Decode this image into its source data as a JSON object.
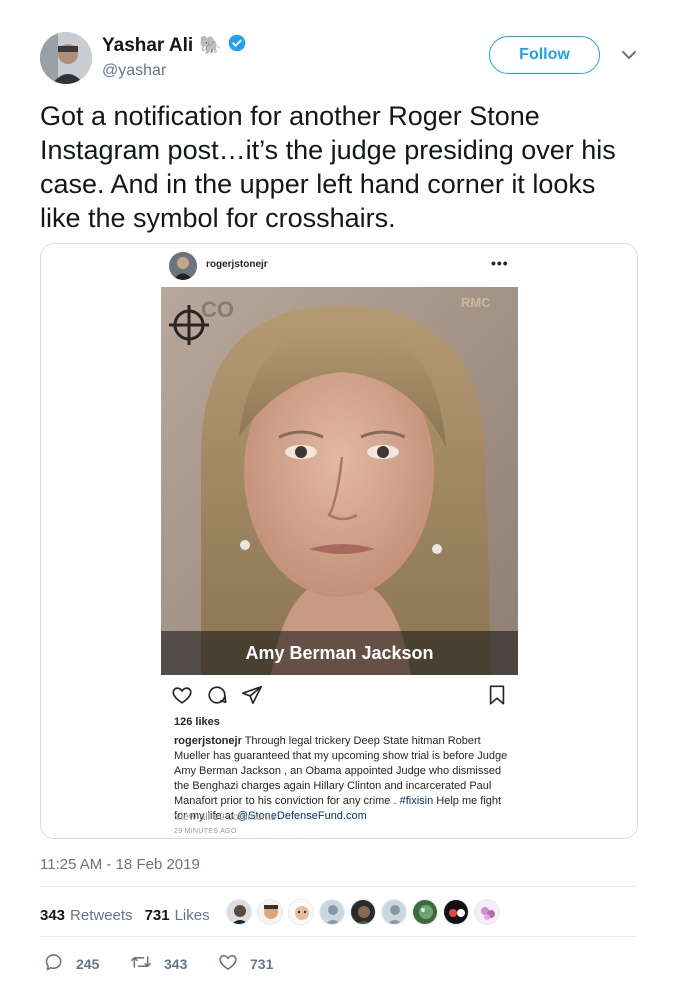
{
  "author": {
    "name": "Yashar Ali",
    "emoji": "🐘",
    "handle": "@yashar"
  },
  "follow_label": "Follow",
  "tweet_text": "Got a notification for another Roger Stone Instagram post…it’s the judge presiding over his case. And in the upper left hand corner it looks like the symbol for crosshairs.",
  "instagram": {
    "username": "rogerjstonejr",
    "more": "•••",
    "photo_caption": "Amy Berman Jackson",
    "likes": "126 likes",
    "caption_user": "rogerjstonejr",
    "caption_text": " Through legal trickery Deep State hitman Robert Mueller has guaranteed that my upcoming show trial is before Judge Amy Berman Jackson , an Obama appointed Judge who dismissed the Benghazi charges again Hillary Clinton and incarcerated Paul Manafort prior to his conviction for any crime . ",
    "hashtag": "#fixisin",
    "caption_mid": " Help me fight for my life at ",
    "mention": "@StoneDefenseFund.com",
    "view_comments": "View all 19 comments",
    "time": "29 MINUTES AGO"
  },
  "timestamp": "11:25 AM - 18 Feb 2019",
  "stats": {
    "retweets": "343",
    "retweets_label": "Retweets",
    "likes": "731",
    "likes_label": "Likes"
  },
  "actions": {
    "replies": "245",
    "retweets": "343",
    "likes": "731"
  },
  "colors": {
    "accent": "#1da1f2",
    "muted": "#657786",
    "text": "#14171a"
  }
}
